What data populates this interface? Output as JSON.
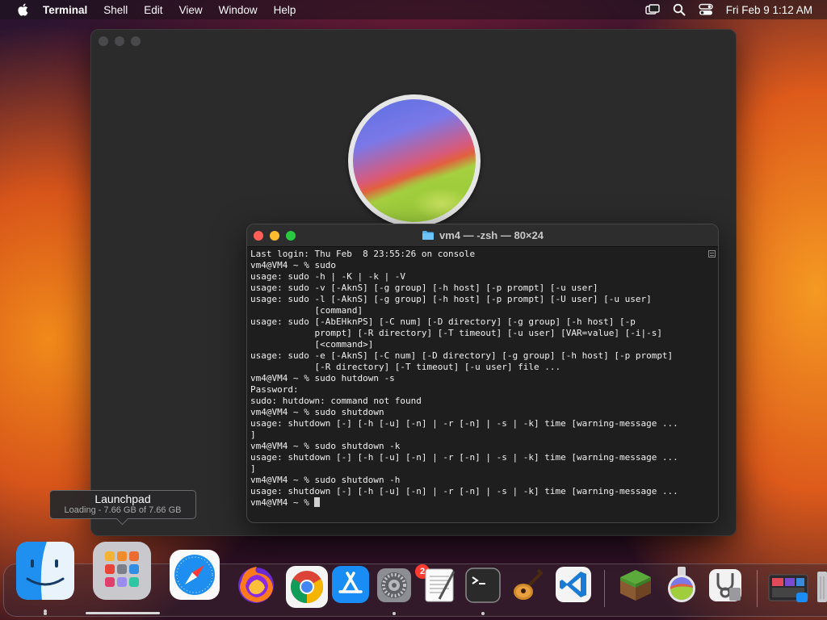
{
  "menubar": {
    "app_name": "Terminal",
    "items": [
      "Shell",
      "Edit",
      "View",
      "Window",
      "Help"
    ],
    "datetime": "Fri Feb 9  1:12 AM"
  },
  "terminal": {
    "title": "vm4 — -zsh — 80×24",
    "lines": [
      "Last login: Thu Feb  8 23:55:26 on console",
      "vm4@VM4 ~ % sudo",
      "usage: sudo -h | -K | -k | -V",
      "usage: sudo -v [-AknS] [-g group] [-h host] [-p prompt] [-u user]",
      "usage: sudo -l [-AknS] [-g group] [-h host] [-p prompt] [-U user] [-u user]",
      "            [command]",
      "usage: sudo [-AbEHknPS] [-C num] [-D directory] [-g group] [-h host] [-p",
      "            prompt] [-R directory] [-T timeout] [-u user] [VAR=value] [-i|-s]",
      "            [<command>]",
      "usage: sudo -e [-AknS] [-C num] [-D directory] [-g group] [-h host] [-p prompt]",
      "            [-R directory] [-T timeout] [-u user] file ...",
      "vm4@VM4 ~ % sudo hutdown -s",
      "Password:",
      "sudo: hutdown: command not found",
      "vm4@VM4 ~ % sudo shutdown",
      "usage: shutdown [-] [-h [-u] [-n] | -r [-n] | -s | -k] time [warning-message ...",
      "]",
      "vm4@VM4 ~ % sudo shutdown -k",
      "usage: shutdown [-] [-h [-u] [-n] | -r [-n] | -s | -k] time [warning-message ...",
      "]",
      "vm4@VM4 ~ % sudo shutdown -h",
      "usage: shutdown [-] [-h [-u] [-n] | -r [-n] | -s | -k] time [warning-message ...",
      "vm4@VM4 ~ % "
    ]
  },
  "tooltip": {
    "title": "Launchpad",
    "subtitle": "Loading - 7.66 GB of 7.66 GB",
    "progress": 1.0
  },
  "dock": {
    "apps": [
      {
        "name": "Finder",
        "icon": "finder-icon",
        "running": true
      },
      {
        "name": "Launchpad",
        "icon": "launchpad-icon",
        "running": false
      },
      {
        "name": "Safari",
        "icon": "safari-icon",
        "running": false
      },
      {
        "name": "Firefox",
        "icon": "firefox-icon",
        "running": false
      },
      {
        "name": "Chrome",
        "icon": "chrome-icon",
        "running": false
      },
      {
        "name": "App Store",
        "icon": "appstore-icon",
        "running": false
      },
      {
        "name": "System Settings",
        "icon": "settings-icon",
        "running": true,
        "badge": "2"
      },
      {
        "name": "TextEdit",
        "icon": "textedit-icon",
        "running": false
      },
      {
        "name": "Terminal",
        "icon": "terminal-icon",
        "running": true
      },
      {
        "name": "GarageBand",
        "icon": "garageband-icon",
        "running": false
      },
      {
        "name": "Visual Studio Code",
        "icon": "vscode-icon",
        "running": false
      },
      {
        "name": "Minecraft",
        "icon": "minecraft-icon",
        "running": false
      },
      {
        "name": "macOS Sonoma Installer",
        "icon": "sonoma-installer-icon",
        "running": false
      },
      {
        "name": "Disk Utility",
        "icon": "disk-utility-icon",
        "running": false
      },
      {
        "name": "Downloads",
        "icon": "downloads-stack-icon",
        "running": false
      },
      {
        "name": "Trash",
        "icon": "trash-icon",
        "running": false
      }
    ]
  },
  "colors": {
    "close": "#ff5f57",
    "minimize": "#febc2e",
    "maximize": "#28c840"
  }
}
